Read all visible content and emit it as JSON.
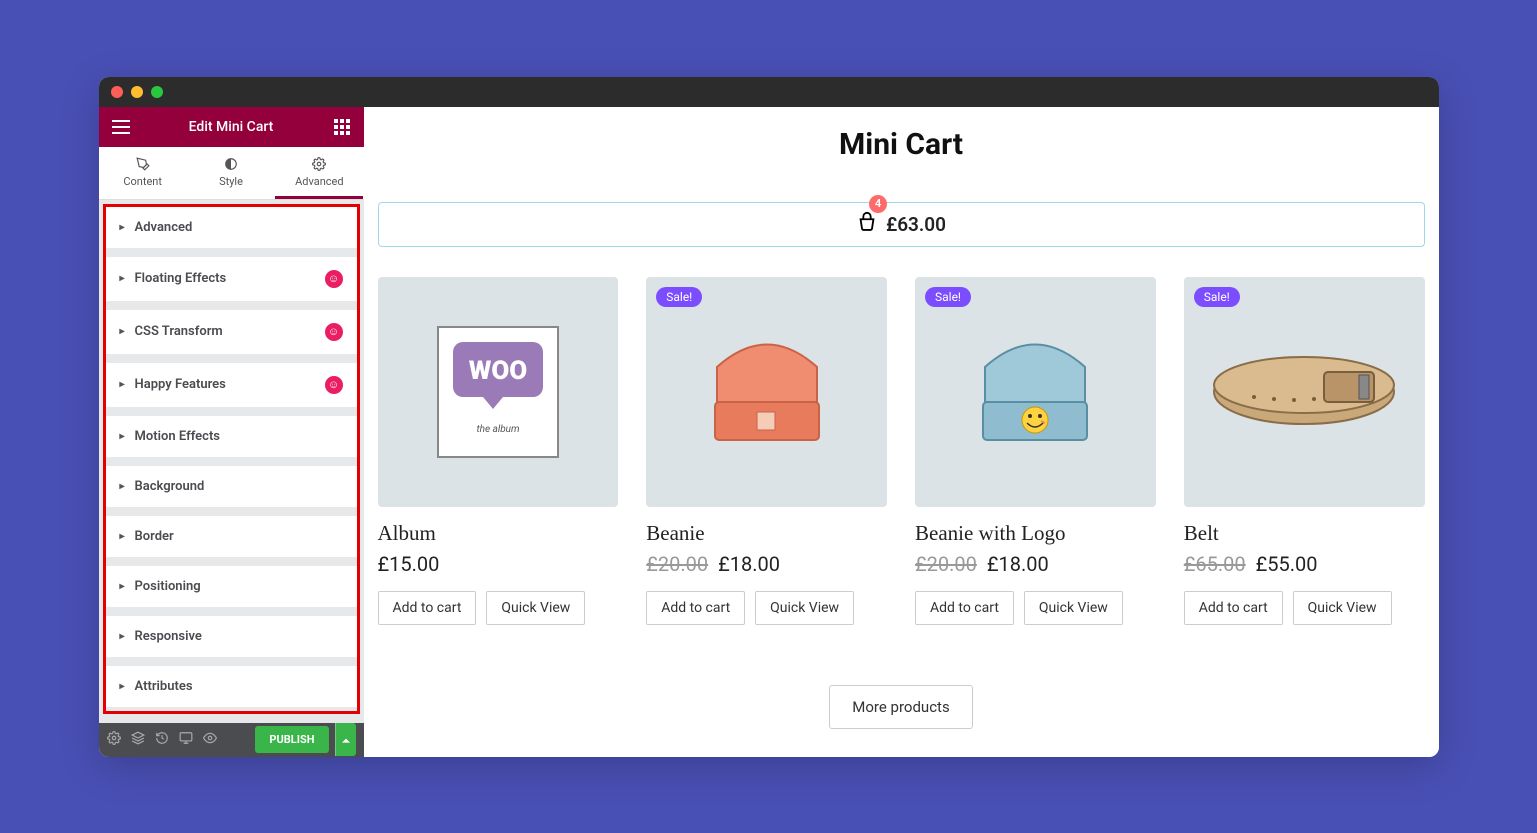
{
  "sidebar": {
    "title": "Edit Mini Cart",
    "tabs": {
      "content": "Content",
      "style": "Style",
      "advanced": "Advanced"
    },
    "panels": [
      {
        "label": "Advanced",
        "happy": false
      },
      {
        "label": "Floating Effects",
        "happy": true
      },
      {
        "label": "CSS Transform",
        "happy": true
      },
      {
        "label": "Happy Features",
        "happy": true
      },
      {
        "label": "Motion Effects",
        "happy": false
      },
      {
        "label": "Background",
        "happy": false
      },
      {
        "label": "Border",
        "happy": false
      },
      {
        "label": "Positioning",
        "happy": false
      },
      {
        "label": "Responsive",
        "happy": false
      },
      {
        "label": "Attributes",
        "happy": false
      }
    ],
    "publish": "PUBLISH"
  },
  "preview": {
    "title": "Mini Cart",
    "cart": {
      "count": "4",
      "total": "£63.00"
    },
    "sale_label": "Sale!",
    "products": [
      {
        "name": "Album",
        "price": "£15.00",
        "old": ""
      },
      {
        "name": "Beanie",
        "price": "£18.00",
        "old": "£20.00"
      },
      {
        "name": "Beanie with Logo",
        "price": "£18.00",
        "old": "£20.00"
      },
      {
        "name": "Belt",
        "price": "£55.00",
        "old": "£65.00"
      }
    ],
    "add_to_cart": "Add to cart",
    "quick_view": "Quick View",
    "more": "More products"
  }
}
